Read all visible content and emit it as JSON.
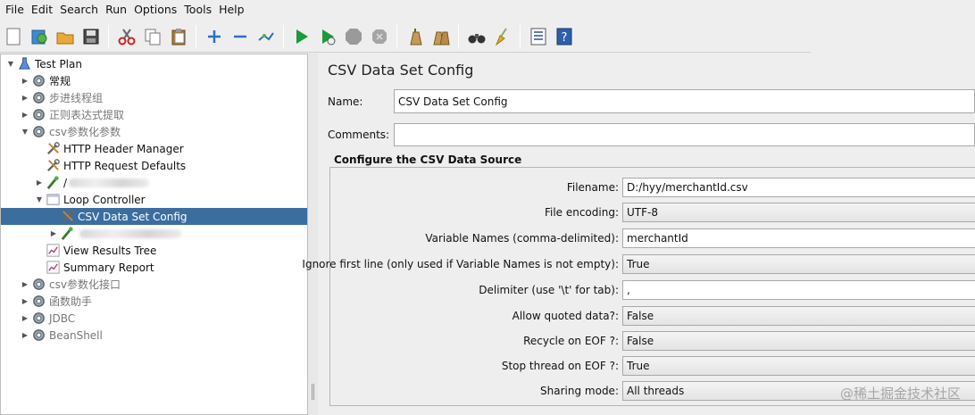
{
  "menu": [
    "File",
    "Edit",
    "Search",
    "Run",
    "Options",
    "Tools",
    "Help"
  ],
  "toolbar": {
    "icons": [
      "new-icon",
      "templates-icon",
      "open-icon",
      "save-icon",
      "cut-icon",
      "copy-icon",
      "paste-icon",
      "expand-icon",
      "collapse-icon",
      "toggle-icon",
      "start-icon",
      "start-no-timers-icon",
      "stop-icon",
      "shutdown-icon",
      "clear-icon",
      "clear-all-icon",
      "search-icon",
      "reset-search-icon",
      "function-helper-icon",
      "help-icon"
    ]
  },
  "tree": {
    "items": [
      {
        "label": "Test Plan",
        "icon": "flask-icon"
      },
      {
        "label": "常规",
        "icon": "thread-group-icon"
      },
      {
        "label": "步进线程组",
        "icon": "thread-group-icon"
      },
      {
        "label": "正则表达式提取",
        "icon": "thread-group-icon"
      },
      {
        "label": "csv参数化参数",
        "icon": "thread-group-icon"
      },
      {
        "label": "HTTP Header Manager",
        "icon": "wrench-icon"
      },
      {
        "label": "HTTP Request Defaults",
        "icon": "wrench-icon"
      },
      {
        "label": "/",
        "icon": "sampler-icon"
      },
      {
        "label": "Loop Controller",
        "icon": "controller-icon"
      },
      {
        "label": "CSV Data Set Config",
        "icon": "wrench-icon"
      },
      {
        "label": "",
        "icon": "sampler-icon"
      },
      {
        "label": "View Results Tree",
        "icon": "listener-icon"
      },
      {
        "label": "Summary Report",
        "icon": "listener-icon"
      },
      {
        "label": "csv参数化接口",
        "icon": "thread-group-icon"
      },
      {
        "label": "函数助手",
        "icon": "thread-group-icon"
      },
      {
        "label": "JDBC",
        "icon": "thread-group-icon"
      },
      {
        "label": "BeanShell",
        "icon": "thread-group-icon"
      }
    ]
  },
  "panel": {
    "title": "CSV Data Set Config",
    "name_label": "Name:",
    "name_value": "CSV Data Set Config",
    "comments_label": "Comments:",
    "comments_value": "",
    "group_title": "Configure the CSV Data Source",
    "fields": [
      {
        "label": "Filename:",
        "value": "D:/hyy/merchantId.csv",
        "kind": "text"
      },
      {
        "label": "File encoding:",
        "value": "UTF-8",
        "kind": "combo"
      },
      {
        "label": "Variable Names (comma-delimited):",
        "value": "merchantId",
        "kind": "text"
      },
      {
        "label": "Ignore first line (only used if Variable Names is not empty):",
        "value": "True",
        "kind": "combo"
      },
      {
        "label": "Delimiter (use '\\t' for tab):",
        "value": ",",
        "kind": "text"
      },
      {
        "label": "Allow quoted data?:",
        "value": "False",
        "kind": "combo"
      },
      {
        "label": "Recycle on EOF ?:",
        "value": "False",
        "kind": "combo"
      },
      {
        "label": "Stop thread on EOF ?:",
        "value": "True",
        "kind": "combo"
      },
      {
        "label": "Sharing mode:",
        "value": "All threads",
        "kind": "combo"
      }
    ]
  },
  "watermark": "@稀土掘金技术社区",
  "colors": {
    "selection": "#3b6e9e",
    "start": "#1a9a3a"
  }
}
